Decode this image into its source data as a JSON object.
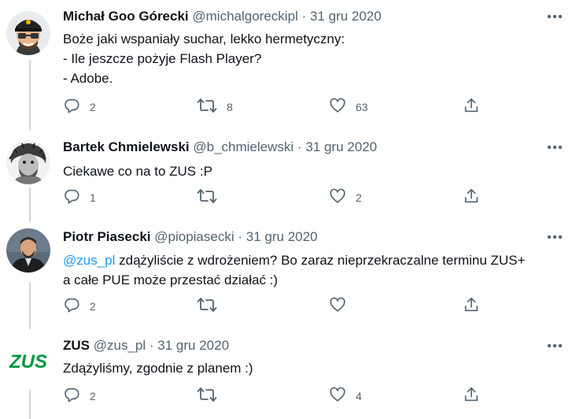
{
  "tweets": [
    {
      "name": "Michał Goo Górecki",
      "handle": "@michalgoreckipl",
      "sep": "·",
      "date": "31 gru 2020",
      "text": "Boże jaki wspaniały suchar, lekko hermetyczny:\n- Ile jeszcze pożyje Flash Player?\n- Adobe.",
      "replies": "2",
      "retweets": "8",
      "likes": "63"
    },
    {
      "name": "Bartek Chmielewski",
      "handle": "@b_chmielewski",
      "sep": "·",
      "date": "31 gru 2020",
      "text": "Ciekawe co na to ZUS :P",
      "replies": "1",
      "retweets": "",
      "likes": "2"
    },
    {
      "name": "Piotr Piasecki",
      "handle": "@piopiasecki",
      "sep": "·",
      "date": "31 gru 2020",
      "mention": "@zus_pl",
      "text": " zdążyliście z wdrożeniem? Bo zaraz nieprzekraczalne terminu ZUS+\na całe PUE może przestać działać :)",
      "replies": "2",
      "retweets": "",
      "likes": ""
    },
    {
      "name": "ZUS",
      "handle": "@zus_pl",
      "sep": "·",
      "date": "31 gru 2020",
      "text": "Zdążyliśmy, zgodnie z planem :)",
      "replies": "2",
      "retweets": "",
      "likes": "4",
      "logo_text": "ZUS"
    }
  ],
  "icons": {
    "reply": "reply-icon",
    "retweet": "retweet-icon",
    "like": "heart-icon",
    "share": "share-icon",
    "more": "more-icon"
  },
  "colors": {
    "text": "#0f1419",
    "secondary": "#536471",
    "link": "#1d9bf0",
    "thread_line": "#cfd9de",
    "zus_green": "#00993f"
  }
}
